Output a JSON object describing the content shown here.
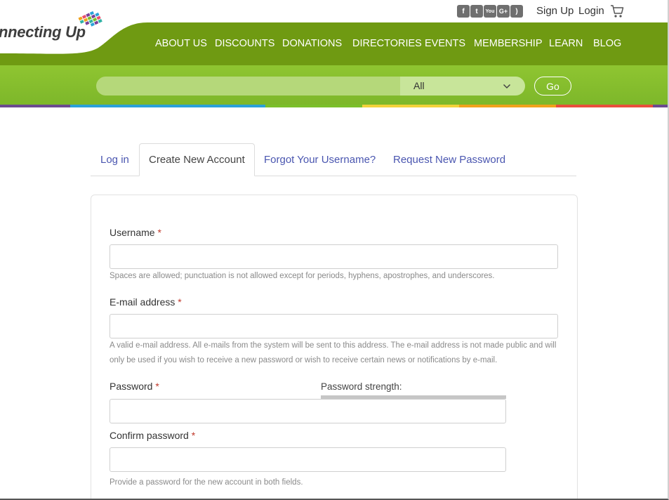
{
  "top": {
    "social": [
      {
        "name": "facebook-icon",
        "glyph": "f"
      },
      {
        "name": "twitter-icon",
        "glyph": "t"
      },
      {
        "name": "youtube-icon",
        "glyph": "You"
      },
      {
        "name": "google-plus-icon",
        "glyph": "G+"
      },
      {
        "name": "rss-icon",
        "glyph": ")"
      }
    ],
    "signup": "Sign Up",
    "login": "Login"
  },
  "logo": {
    "text": "nnecting Up"
  },
  "nav": [
    "ABOUT US",
    "DISCOUNTS",
    "DONATIONS",
    "DIRECTORIES",
    "EVENTS",
    "MEMBERSHIP",
    "LEARN",
    "BLOG"
  ],
  "search": {
    "value": "",
    "scope": "All",
    "go": "Go"
  },
  "colors": {
    "nav_green": "#6f9a12",
    "search_green": "#86bf2d",
    "link_blue": "#4a56b0",
    "required_red": "#c0392b"
  },
  "tabs": [
    "Log in",
    "Create New Account",
    "Forgot Your Username?",
    "Request New Password"
  ],
  "form": {
    "username_label": "Username",
    "username_help": "Spaces are allowed; punctuation is not allowed except for periods, hyphens, apostrophes, and underscores.",
    "email_label": "E-mail address",
    "email_help": "A valid e-mail address. All e-mails from the system will be sent to this address. The e-mail address is not made public and will only be used if you wish to receive a new password or wish to receive certain news or notifications by e-mail.",
    "password_label": "Password",
    "strength_label": "Password strength:",
    "confirm_label": "Confirm password",
    "password_help": "Provide a password for the new account in both fields.",
    "required_mark": "*"
  }
}
